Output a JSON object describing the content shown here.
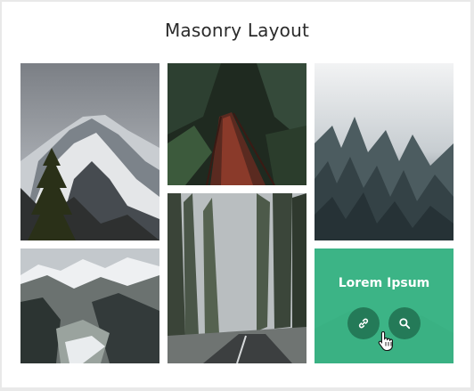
{
  "header": {
    "title": "Masonry Layout"
  },
  "gallery": {
    "items": [
      {
        "alt": "snowy-mountain-photo"
      },
      {
        "alt": "forest-bridge-photo"
      },
      {
        "alt": "misty-forest-photo"
      },
      {
        "alt": "mountain-valley-photo"
      },
      {
        "alt": "forest-road-photo"
      },
      {
        "alt": "hover-card",
        "overlay_title": "Lorem Ipsum",
        "buttons": [
          "link-icon",
          "search-icon"
        ]
      }
    ]
  },
  "colors": {
    "overlay": "#3cbe8c",
    "button": "#247a58"
  }
}
